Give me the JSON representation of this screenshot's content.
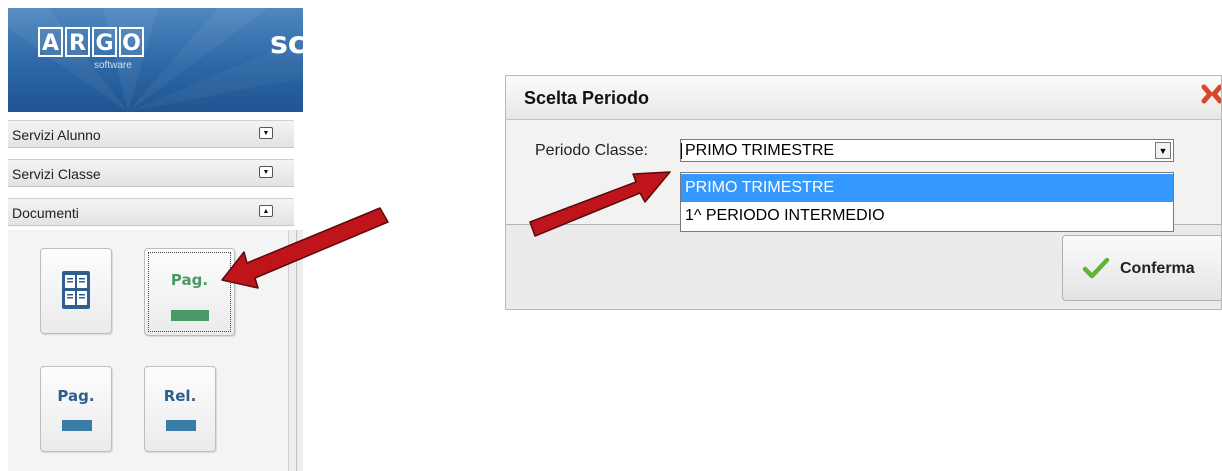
{
  "sidebar": {
    "logo_letters": [
      "A",
      "R",
      "G",
      "O"
    ],
    "logo_subtitle": "software",
    "header_title": "sc",
    "sections": [
      {
        "label": "Servizi Alunno",
        "state": "collapsed"
      },
      {
        "label": "Servizi Classe",
        "state": "collapsed"
      },
      {
        "label": "Documenti",
        "state": "expanded"
      }
    ],
    "tiles": [
      {
        "label": "",
        "icon": "document-grid-icon"
      },
      {
        "label": "Pag.",
        "bar_color": "#4a9a67",
        "label_color": "#4a9a67"
      },
      {
        "label": "Pag.",
        "bar_color": "#3a7ca5",
        "label_color": "#2f5f8f"
      },
      {
        "label": "Rel.",
        "bar_color": "#3a7ca5",
        "label_color": "#2f5f8f"
      }
    ]
  },
  "dialog": {
    "title": "Scelta Periodo",
    "field_label": "Periodo Classe:",
    "selected_value": "PRIMO TRIMESTRE",
    "options": [
      "PRIMO TRIMESTRE",
      "1^ PERIODO INTERMEDIO"
    ],
    "confirm_label": "Conferma"
  },
  "colors": {
    "accent": "#3399ff",
    "annotation_arrow": "#c0141b",
    "header_blue": "#2c67a6",
    "check_green": "#5fb336"
  }
}
